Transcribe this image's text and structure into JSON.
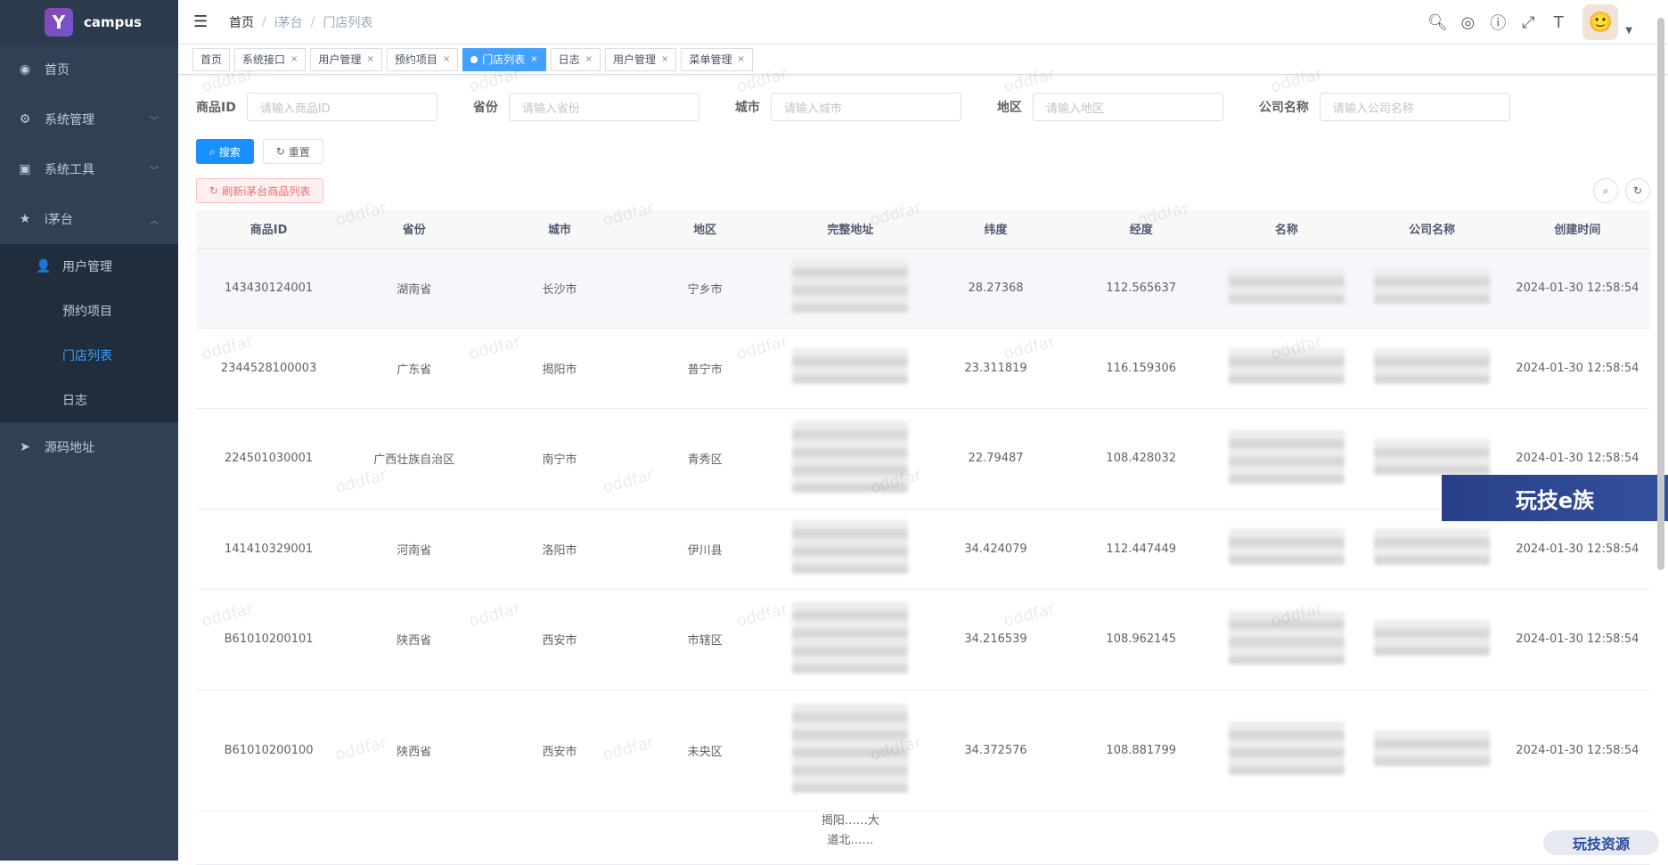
{
  "app": {
    "logo_text": "campus",
    "logo_glyph": "Y"
  },
  "sidebar": {
    "items": [
      {
        "label": "首页",
        "icon": "dashboard-icon"
      },
      {
        "label": "系统管理",
        "icon": "gear-icon"
      },
      {
        "label": "系统工具",
        "icon": "toolbox-icon"
      },
      {
        "label": "i茅台",
        "icon": "star-icon"
      },
      {
        "label": "源码地址",
        "icon": "send-icon"
      }
    ],
    "submenu": {
      "group_label": "用户管理",
      "items": [
        "预约项目",
        "门店列表",
        "日志"
      ]
    }
  },
  "breadcrumb": [
    "首页",
    "i茅台",
    "门店列表"
  ],
  "tags": [
    {
      "label": "首页"
    },
    {
      "label": "系统接口"
    },
    {
      "label": "用户管理"
    },
    {
      "label": "预约项目"
    },
    {
      "label": "门店列表"
    },
    {
      "label": "日志"
    },
    {
      "label": "用户管理"
    },
    {
      "label": "菜单管理"
    }
  ],
  "filters": {
    "labels": [
      "商品ID",
      "省份",
      "城市",
      "地区",
      "公司名称"
    ],
    "placeholders": [
      "请输入商品ID",
      "请输入省份",
      "请输入城市",
      "请输入地区",
      "请输入公司名称"
    ]
  },
  "buttons": {
    "search": "搜索",
    "reset": "重置",
    "refresh_list": "刷新i茅台商品列表"
  },
  "table": {
    "columns": [
      "商品ID",
      "省份",
      "城市",
      "地区",
      "完整地址",
      "纬度",
      "经度",
      "名称",
      "公司名称",
      "创建时间"
    ],
    "rows": [
      {
        "id": "143430124001",
        "province": "湖南省",
        "city": "长沙市",
        "district": "宁乡市",
        "lat": "28.27368",
        "lng": "112.565637",
        "created": "2024-01-30 12:58:54"
      },
      {
        "id": "2344528100003",
        "province": "广东省",
        "city": "揭阳市",
        "district": "普宁市",
        "lat": "23.311819",
        "lng": "116.159306",
        "created": "2024-01-30 12:58:54"
      },
      {
        "id": "224501030001",
        "province": "广西壮族自治区",
        "city": "南宁市",
        "district": "青秀区",
        "lat": "22.79487",
        "lng": "108.428032",
        "created": "2024-01-30 12:58:54"
      },
      {
        "id": "141410329001",
        "province": "河南省",
        "city": "洛阳市",
        "district": "伊川县",
        "lat": "34.424079",
        "lng": "112.447449",
        "created": "2024-01-30 12:58:54"
      },
      {
        "id": "B61010200101",
        "province": "陕西省",
        "city": "西安市",
        "district": "市辖区",
        "lat": "34.216539",
        "lng": "108.962145",
        "created": "2024-01-30 12:58:54"
      },
      {
        "id": "B61010200100",
        "province": "陕西省",
        "city": "西安市",
        "district": "未央区",
        "lat": "34.372576",
        "lng": "108.881799",
        "created": "2024-01-30 12:58:54"
      }
    ],
    "partial_address": [
      "揭阳",
      "大",
      "道北"
    ]
  },
  "watermark": "oddfar",
  "overlays": {
    "banner": "玩技e族",
    "badge": "玩技资源"
  }
}
